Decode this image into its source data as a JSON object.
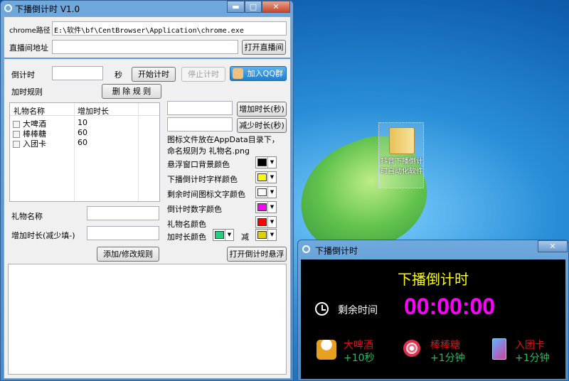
{
  "main_window": {
    "title": "下播倒计时 V1.0",
    "chrome_path_label": "chrome路径",
    "chrome_path_value": "E:\\软件\\bf\\CentBrowser\\Application\\chrome.exe",
    "room_url_label": "直播间地址",
    "room_url_value": "",
    "open_room_button": "打开直播间",
    "countdown_label": "倒计时",
    "countdown_value": "",
    "seconds_unit": "秒",
    "start_button": "开始计时",
    "stop_button": "停止计时",
    "qq_button": "加入QQ群",
    "rules_label": "加时规则",
    "delete_rule_button": "删 除 规 则",
    "table": {
      "headers": [
        "礼物名称",
        "增加时长"
      ],
      "rows": [
        {
          "name": "大啤酒",
          "value": "10",
          "checked": false
        },
        {
          "name": "棒棒糖",
          "value": "60",
          "checked": false
        },
        {
          "name": "入团卡",
          "value": "60",
          "checked": false
        }
      ]
    },
    "gift_name_label": "礼物名称",
    "add_time_label": "增加时长(减少填-)",
    "add_modify_button": "添加/修改规则",
    "increase_button": "增加时长(秒)",
    "decrease_button": "减少时长(秒)",
    "icon_note_1": "图标文件放在AppData目录下，",
    "icon_note_2": "命名规则为 礼物名.png",
    "colors": [
      {
        "label": "悬浮窗口背景颜色",
        "color": "#000000"
      },
      {
        "label": "下播倒计时字样颜色",
        "color": "#ffff00"
      },
      {
        "label": "剩余时间图标文字颜色",
        "color": "#ffffff"
      },
      {
        "label": "倒计时数字颜色",
        "color": "#ff00ff"
      },
      {
        "label": "礼物名颜色",
        "color": "#ff0000"
      }
    ],
    "add_color_label": "加时长颜色",
    "add_color": "#20d080",
    "sub_color_label": "减",
    "sub_color": "#e0d000",
    "open_float_button": "打开倒计时悬浮",
    "log_text": ""
  },
  "desktop_icon": {
    "label": "抖音下播倒计时自动化软件"
  },
  "overlay": {
    "title": "下播倒计时",
    "heading": "下播倒计时",
    "remaining_label": "剩余时间",
    "time": "00:00:00",
    "gifts": [
      {
        "name": "大啤酒",
        "bonus": "+10秒",
        "icon": "beer-icon"
      },
      {
        "name": "棒棒糖",
        "bonus": "+1分钟",
        "icon": "lollipop-icon"
      },
      {
        "name": "入团卡",
        "bonus": "+1分钟",
        "icon": "card-icon"
      }
    ]
  }
}
